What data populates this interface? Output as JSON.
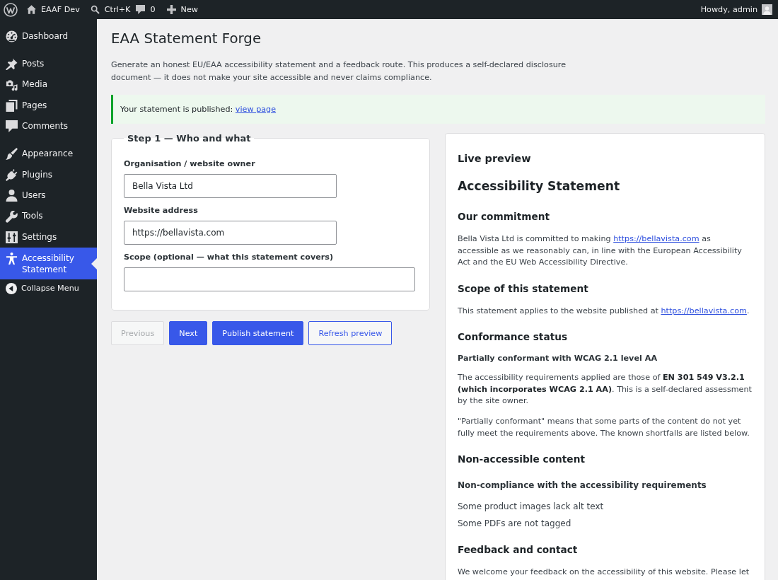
{
  "admin_bar": {
    "site_name": "EAAF Dev",
    "search_shortcut": "Ctrl+K",
    "comment_count": "0",
    "new_label": "New",
    "greeting": "Howdy, admin"
  },
  "sidebar": {
    "groups": [
      {
        "items": [
          {
            "label": "Dashboard",
            "selected": false
          }
        ]
      },
      {
        "items": [
          {
            "label": "Posts",
            "selected": false
          },
          {
            "label": "Media",
            "selected": false
          },
          {
            "label": "Pages",
            "selected": false
          },
          {
            "label": "Comments",
            "selected": false
          }
        ]
      },
      {
        "items": [
          {
            "label": "Appearance",
            "selected": false
          },
          {
            "label": "Plugins",
            "selected": false
          },
          {
            "label": "Users",
            "selected": false
          },
          {
            "label": "Tools",
            "selected": false
          },
          {
            "label": "Settings",
            "selected": false
          },
          {
            "label": "Accessibility Statement",
            "selected": true
          }
        ]
      }
    ],
    "collapse_label": "Collapse Menu"
  },
  "page": {
    "title": "EAA Statement Forge",
    "description": "Generate an honest EU/EAA accessibility statement and a feedback route. This produces a self-declared disclosure document — it does not make your site accessible and never claims compliance.",
    "notice": {
      "text": "Your statement is published:",
      "link": "view page"
    }
  },
  "step": {
    "legend": "Step 1 — Who and what",
    "fields": [
      {
        "label": "Organisation / website owner",
        "value": "Bella Vista Ltd",
        "kind": "regular"
      },
      {
        "label": "Website address",
        "value": "https://bellavista.com",
        "kind": "regular"
      },
      {
        "label": "Scope (optional — what this statement covers)",
        "kind": "large"
      }
    ]
  },
  "buttons": [
    {
      "label": "Previous",
      "kind": "secondary",
      "disabled": true
    },
    {
      "label": "Next",
      "kind": "primary",
      "disabled": false
    },
    {
      "label": "Publish statement",
      "kind": "primary",
      "disabled": false
    },
    {
      "label": "Refresh preview",
      "kind": "secondary",
      "disabled": false
    }
  ],
  "preview": {
    "heading": "Live preview",
    "title": "Accessibility Statement",
    "sections": [
      {
        "heading": "Our commitment",
        "blocks": [
          {
            "kind": "paragraph",
            "parts": [
              {
                "kind": "text",
                "text": "Bella Vista Ltd is committed to making "
              },
              {
                "kind": "link",
                "text": "https://bellavista.com"
              },
              {
                "kind": "text",
                "text": " as accessible as we reasonably can, in line with the European Accessibility Act and the EU Web Accessibility Directive."
              }
            ]
          }
        ]
      },
      {
        "heading": "Scope of this statement",
        "blocks": [
          {
            "kind": "paragraph",
            "parts": [
              {
                "kind": "text",
                "text": "This statement applies to the website published at "
              },
              {
                "kind": "link",
                "text": "https://bellavista.com"
              },
              {
                "kind": "text",
                "text": "."
              }
            ]
          }
        ]
      },
      {
        "heading": "Conformance status",
        "blocks": [
          {
            "kind": "status",
            "text": "Partially conformant with WCAG 2.1 level AA"
          },
          {
            "kind": "paragraph",
            "parts": [
              {
                "kind": "text",
                "text": "The accessibility requirements applied are those of **EN 301 549 V3.2.1 (which incorporates WCAG 2.1 AA)**. This is a self-declared assessment by the site owner."
              }
            ]
          },
          {
            "kind": "paragraph",
            "parts": [
              {
                "kind": "text",
                "text": "\"Partially conformant\" means that some parts of the content do not yet fully meet the requirements above. The known shortfalls are listed below."
              }
            ]
          }
        ]
      },
      {
        "heading": "Non-accessible content",
        "blocks": [
          {
            "kind": "subheading",
            "text": "Non-compliance with the accessibility requirements"
          },
          {
            "kind": "list",
            "items": [
              "Some product images lack alt text",
              "Some PDFs are not tagged"
            ]
          }
        ]
      },
      {
        "heading": "Feedback and contact",
        "blocks": [
          {
            "kind": "paragraph",
            "parts": [
              {
                "kind": "text",
                "text": "We welcome your feedback on the accessibility of this website. Please let"
              }
            ]
          }
        ]
      }
    ]
  }
}
